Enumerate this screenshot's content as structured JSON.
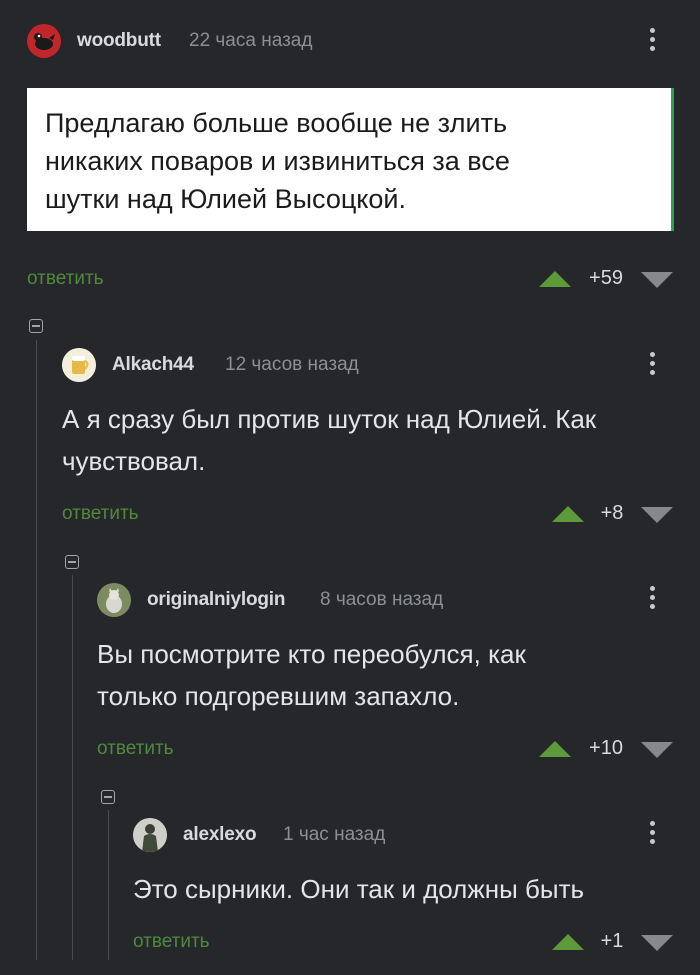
{
  "comments": [
    {
      "author": "woodbutt",
      "time": "22 часа назад",
      "quote_lines": [
        "Предлагаю больше вообще не злить",
        "никаких поваров и извиниться за все",
        "шутки над Юлией Высоцкой."
      ],
      "reply_label": "ответить",
      "score": "+59"
    },
    {
      "author": "Alkach44",
      "time": "12 часов назад",
      "lines": [
        "А я сразу был против шуток над Юлией. Как",
        "чувствовал."
      ],
      "reply_label": "ответить",
      "score": "+8"
    },
    {
      "author": "originalniylogin",
      "time": "8 часов назад",
      "lines": [
        "Вы посмотрите кто переобулся, как",
        "только подгоревшим запахло."
      ],
      "reply_label": "ответить",
      "score": "+10"
    },
    {
      "author": "alexlexo",
      "time": "1 час назад",
      "lines": [
        "Это сырники. Они так и должны быть"
      ],
      "reply_label": "ответить",
      "score": "+1"
    }
  ],
  "icons": {
    "more": "more-vertical-icon",
    "upvote": "upvote-icon",
    "downvote": "downvote-icon",
    "collapse": "collapse-thread-icon"
  },
  "colors": {
    "background": "#25272b",
    "reply_link": "#4f8a3c",
    "upvote": "#5c9a3a",
    "downvote": "#85888d"
  }
}
